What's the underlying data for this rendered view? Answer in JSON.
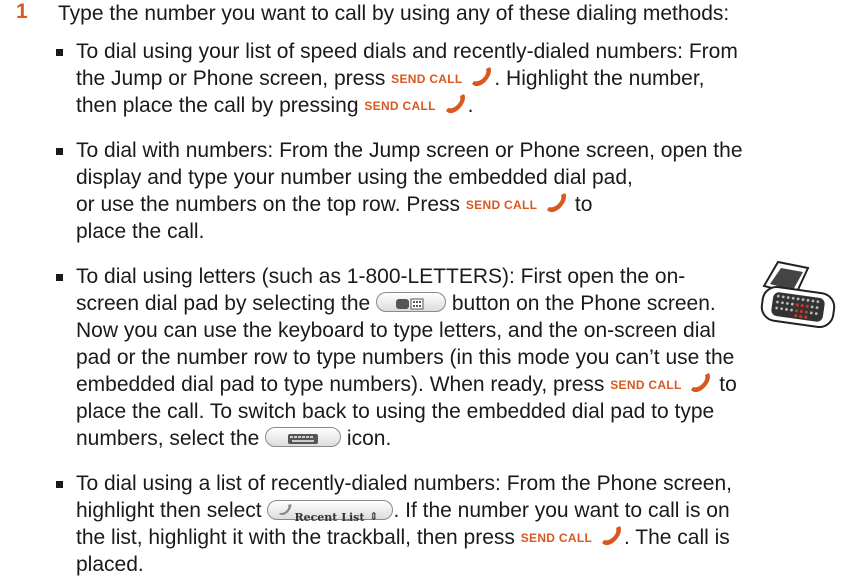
{
  "step": {
    "number": "1",
    "intro": "Type the number you want to call by using any of these dialing methods:"
  },
  "send_call_label": "SEND CALL",
  "icons": {
    "handset": "phone-handset-icon",
    "dialpad_button": "dialpad-button-icon",
    "keyboard_button": "keyboard-button-icon",
    "recent_list_selector": "recent-list-selector",
    "device": "sidekick-device-illustration"
  },
  "recent_list_label": "Recent List",
  "bullets": [
    {
      "lines": [
        {
          "a": "To dial using your list of speed dials and recently-dialed numbers: From"
        },
        {
          "a": "the Jump or Phone screen, press ",
          "b": ". Highlight the number,"
        },
        {
          "a": "then place the call by pressing ",
          "b": "."
        }
      ]
    },
    {
      "lines": [
        {
          "a": "To dial with numbers: From the Jump screen or Phone screen, open the"
        },
        {
          "a": "display and type your number using the embedded dial pad,"
        },
        {
          "a": "or use the numbers on the top row. Press ",
          "b": " to"
        },
        {
          "a": "place the call."
        }
      ]
    },
    {
      "lines": [
        {
          "a": "To dial using letters (such as 1-800-LETTERS): First open the on-"
        },
        {
          "a": "screen dial pad by selecting the ",
          "b": " button on the Phone screen."
        },
        {
          "a": "Now you can use the keyboard to type letters, and the on-screen dial"
        },
        {
          "a": "pad or the number row to type numbers (in this mode you can’t use the"
        },
        {
          "a": "embedded dial pad to type numbers). When ready, press ",
          "b": " to"
        },
        {
          "a": "place the call. To switch back to using the embedded dial pad to type"
        },
        {
          "a": "numbers, select the ",
          "b": " icon."
        }
      ]
    },
    {
      "lines": [
        {
          "a": "To dial using a list of recently-dialed numbers: From the Phone screen,"
        },
        {
          "a": "highlight then select ",
          "b": ". If the number you want to call is on"
        },
        {
          "a": "the list, highlight it with the trackball, then press ",
          "b": ". The call is"
        },
        {
          "a": "placed."
        }
      ]
    }
  ]
}
